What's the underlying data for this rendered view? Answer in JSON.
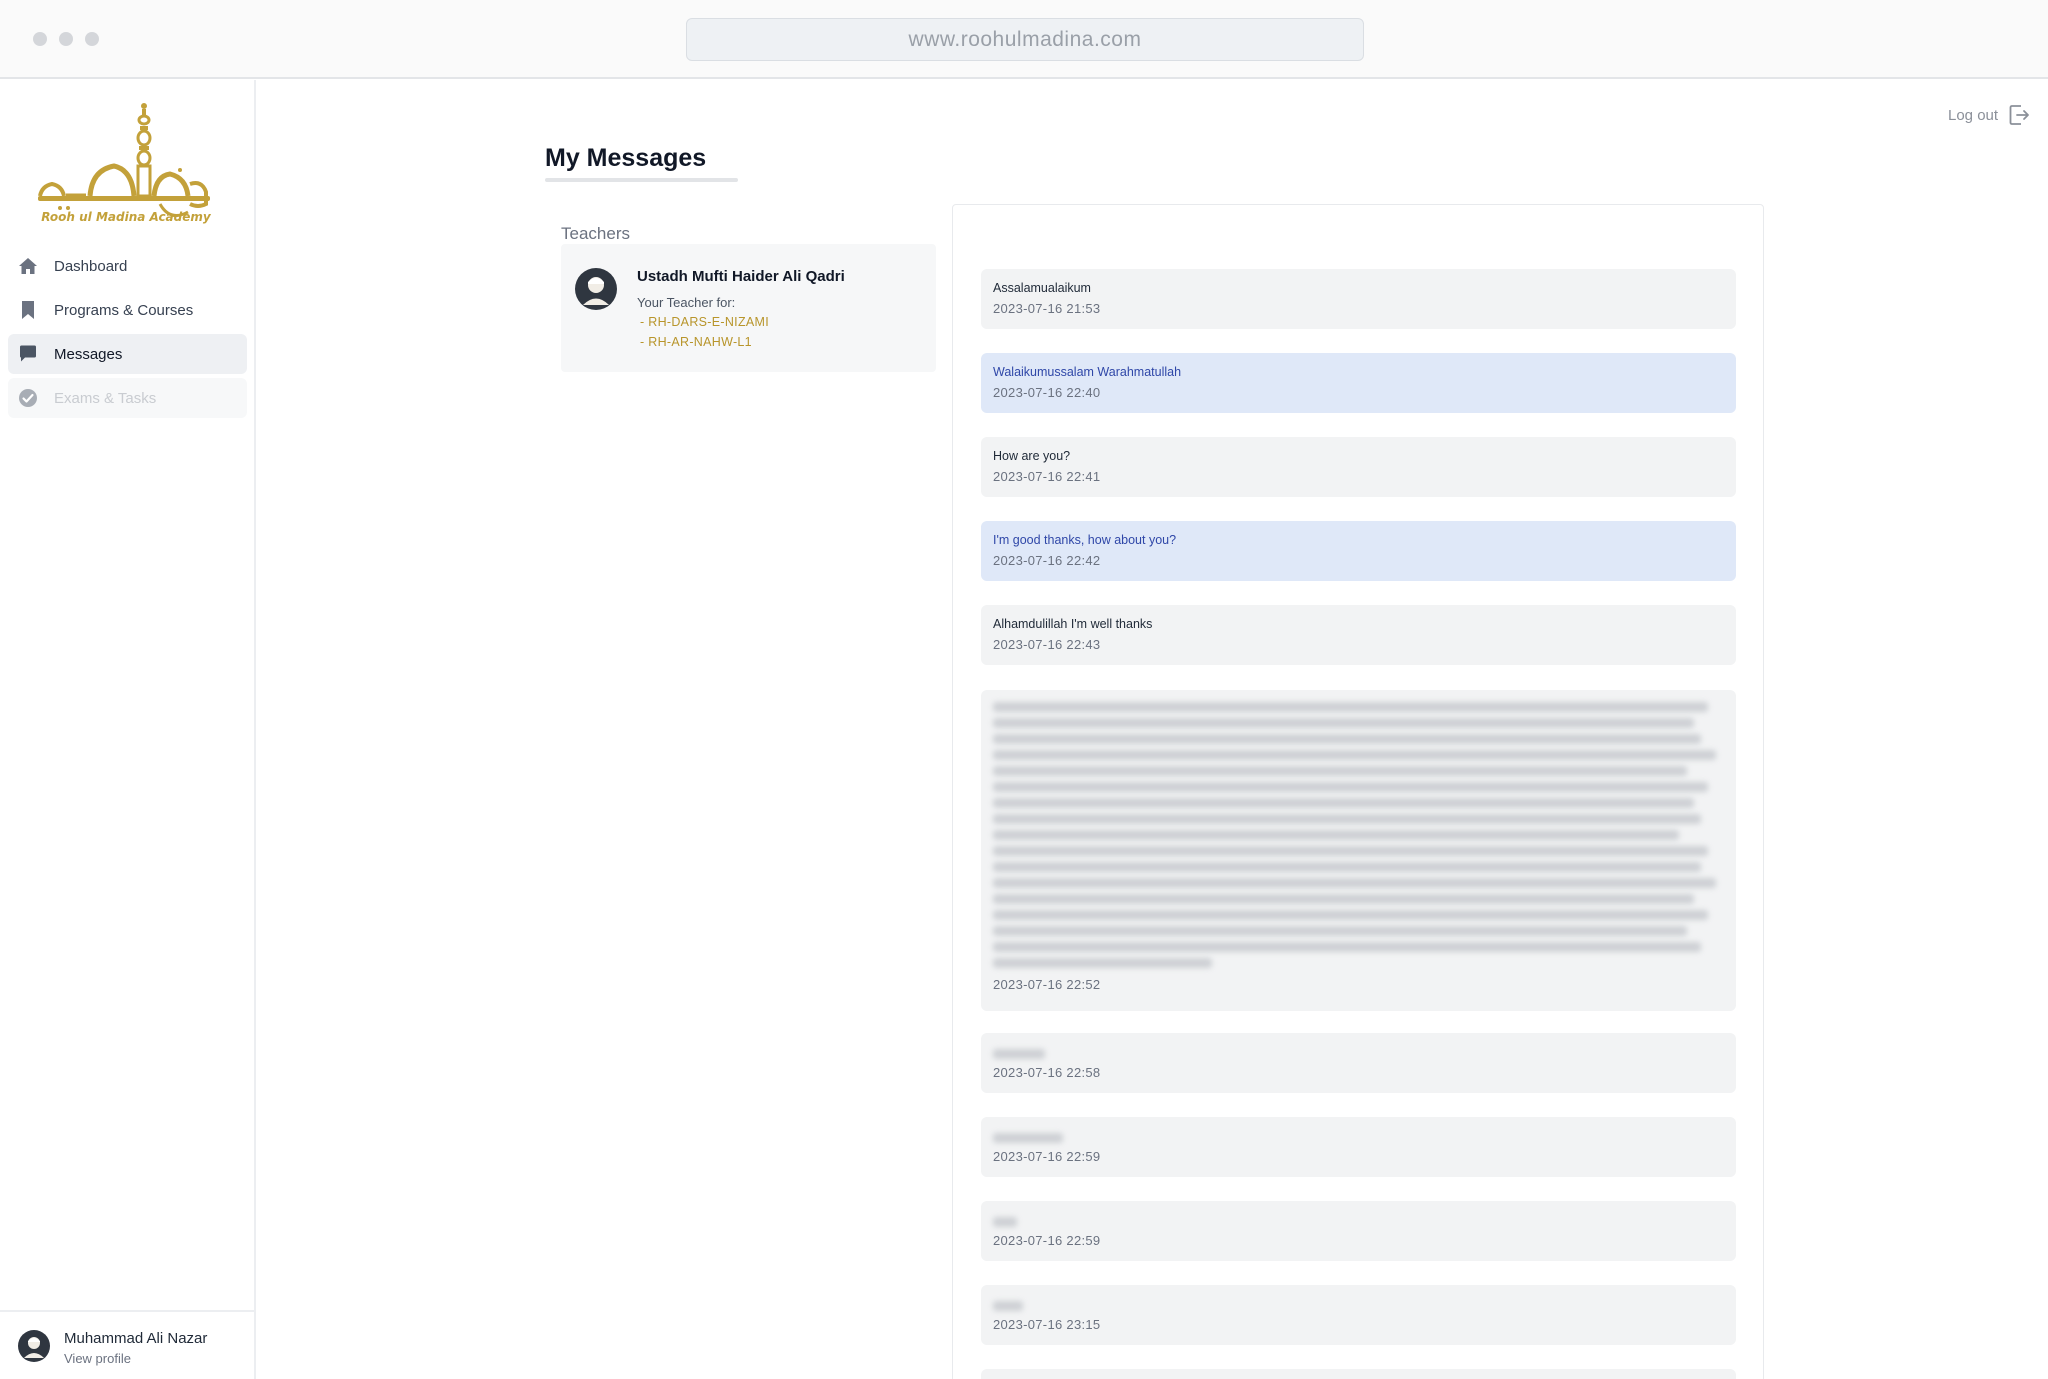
{
  "browser": {
    "url": "www.roohulmadina.com"
  },
  "sidebar": {
    "logo": {
      "arabic": "روح المدينة",
      "caption": "Rooh ul Madina Academy"
    },
    "items": [
      {
        "label": "Dashboard",
        "icon": "home-icon",
        "state": "normal"
      },
      {
        "label": "Programs & Courses",
        "icon": "bookmark-icon",
        "state": "normal"
      },
      {
        "label": "Messages",
        "icon": "chat-icon",
        "state": "active"
      },
      {
        "label": "Exams & Tasks",
        "icon": "check-circle-icon",
        "state": "disabled"
      }
    ],
    "profile": {
      "name": "Muhammad Ali Nazar",
      "link": "View profile"
    }
  },
  "header": {
    "logout_label": "Log out"
  },
  "main": {
    "title": "My Messages",
    "teachers_label": "Teachers",
    "teacher": {
      "name": "Ustadh Mufti Haider Ali Qadri",
      "subtitle": "Your Teacher for:",
      "courses": [
        "- RH-DARS-E-NIZAMI",
        "- RH-AR-NAHW-L1"
      ]
    },
    "messages": [
      {
        "text": "Assalamualaikum",
        "time": "2023-07-16 21:53",
        "mine": false
      },
      {
        "text": "Walaikumussalam Warahmatullah",
        "time": "2023-07-16 22:40",
        "mine": true
      },
      {
        "text": "How are you?",
        "time": "2023-07-16 22:41",
        "mine": false
      },
      {
        "text": "I'm good thanks, how about you?",
        "time": "2023-07-16 22:42",
        "mine": true
      },
      {
        "text": "Alhamdulillah I'm well thanks",
        "time": "2023-07-16 22:43",
        "mine": false
      },
      {
        "text": "",
        "time": "2023-07-16 22:52",
        "mine": false,
        "blurred": true
      },
      {
        "text": "",
        "time": "2023-07-16 22:58",
        "mine": false,
        "blurred": true
      },
      {
        "text": "",
        "time": "2023-07-16 22:59",
        "mine": false,
        "blurred": true
      },
      {
        "text": "",
        "time": "2023-07-16 22:59",
        "mine": false,
        "blurred": true
      },
      {
        "text": "",
        "time": "2023-07-16 23:15",
        "mine": false,
        "blurred": true
      }
    ]
  },
  "colors": {
    "brand_gold": "#b8952b",
    "mine_bubble": "#dfe8f8",
    "other_bubble": "#f2f3f4"
  }
}
